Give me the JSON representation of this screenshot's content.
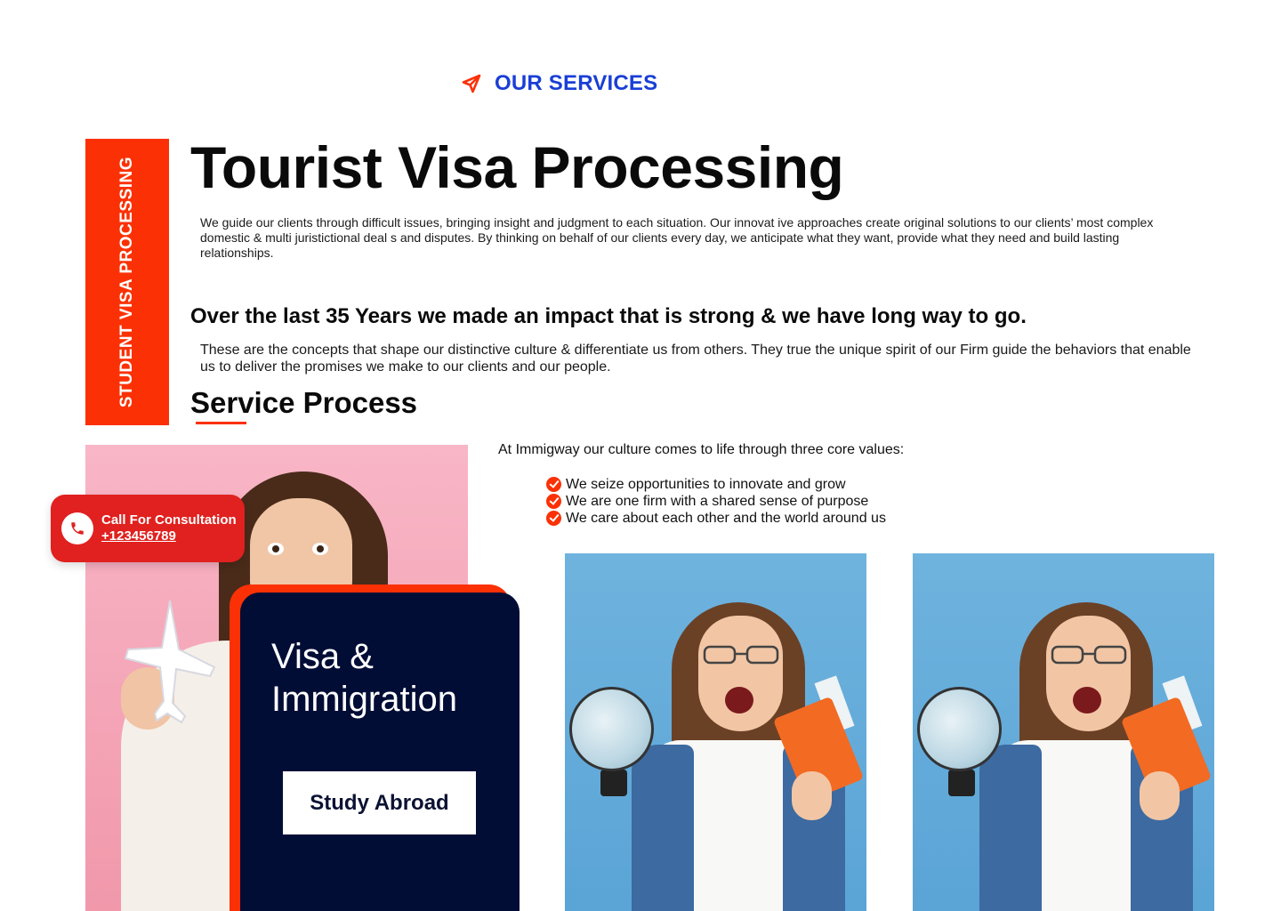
{
  "eyebrow": {
    "label": "OUR SERVICES",
    "icon": "send-arrow-icon",
    "color": "#1a3fd6",
    "icon_color": "#fb3105"
  },
  "side_banner": {
    "label": "STUDENT VISA PROCESSING",
    "color": "#fb3105"
  },
  "main": {
    "title": "Tourist Visa Processing",
    "intro": "We guide our clients through difficult issues, bringing insight and judgment to each situation. Our innovat ive approaches create original solutions to our clients’ most complex domestic & multi juristictional deal s and disputes. By thinking on behalf of our clients every day, we anticipate what they want, provide what they need and build lasting relationships.",
    "impact_heading": "Over the last 35 Years we made an impact that is strong & we have long way to go.",
    "impact_text": "These are the concepts that shape our distinctive culture & differentiate us from others. They true the unique spirit of our Firm guide the behaviors that enable us to deliver the promises we make to our clients and our people.",
    "process_heading": "Service Process"
  },
  "values": {
    "intro": "At Immigway our culture comes to life through three core values:",
    "items": [
      "We seize opportunities to innovate and grow",
      "We are one firm with a shared sense of purpose",
      "We care about each other and the world around us"
    ]
  },
  "call": {
    "label": "Call For Consultation",
    "number": "+123456789",
    "icon": "phone-icon",
    "color": "#e0211f"
  },
  "visa_card": {
    "title_line1": "Visa &",
    "title_line2": "Immigration",
    "button": "Study Abroad",
    "background": "#020d36",
    "accent": "#fb3105"
  }
}
